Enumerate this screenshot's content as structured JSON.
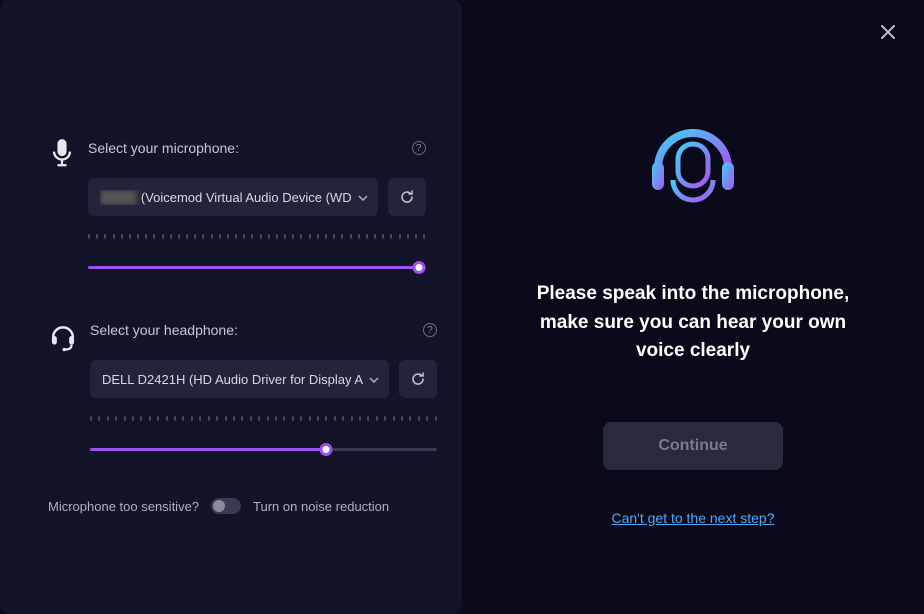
{
  "left": {
    "microphone": {
      "label": "Select your microphone:",
      "selected_prefix": "████",
      "selected_rest": "(Voicemod Virtual Audio Device (WD",
      "level_percent": 98
    },
    "headphone": {
      "label": "Select your headphone:",
      "selected": "DELL D2421H (HD Audio Driver for Display A",
      "level_percent": 68
    },
    "noise": {
      "question": "Microphone too sensitive?",
      "hint": "Turn on noise reduction",
      "enabled": false
    }
  },
  "right": {
    "instruction": "Please speak into the microphone, make sure you can hear your own voice clearly",
    "continue_label": "Continue",
    "link_label": "Can't get to the next step?"
  }
}
